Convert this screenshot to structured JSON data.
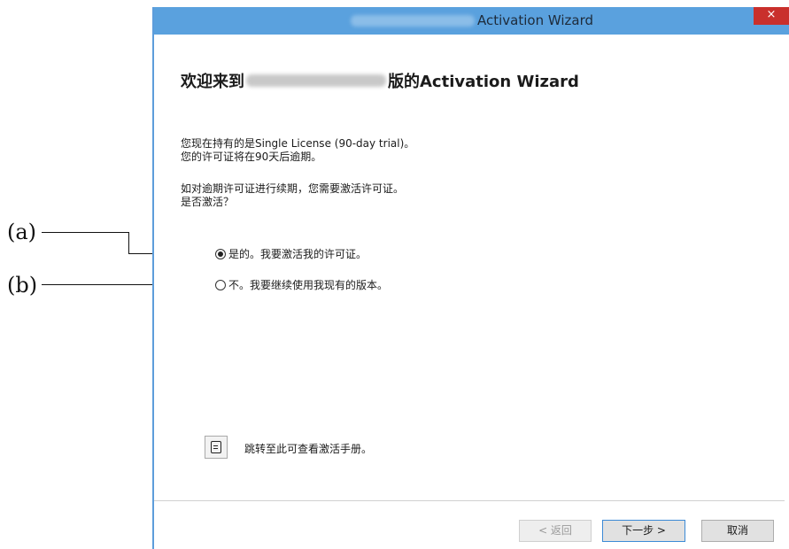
{
  "annotations": {
    "a_label": "(a)",
    "b_label": "(b)"
  },
  "window": {
    "title": "Activation Wizard",
    "close_glyph": "×"
  },
  "content": {
    "heading_prefix": "欢迎来到",
    "heading_suffix": "版的Activation Wizard",
    "license_line1": "您现在持有的是Single License (90-day trial)。",
    "license_line2": "您的许可证将在90天后逾期。",
    "question_line1": "如对逾期许可证进行续期，您需要激活许可证。",
    "question_line2": "是否激活？"
  },
  "options": [
    {
      "label": "是的。我要激活我的许可证。",
      "checked": true
    },
    {
      "label": "不。我要继续使用我现有的版本。",
      "checked": false
    }
  ],
  "manual": {
    "icon": "document-icon",
    "text": "跳转至此可查看激活手册。"
  },
  "buttons": {
    "back": "< 返回",
    "next": "下一步 >",
    "cancel": "取消"
  }
}
